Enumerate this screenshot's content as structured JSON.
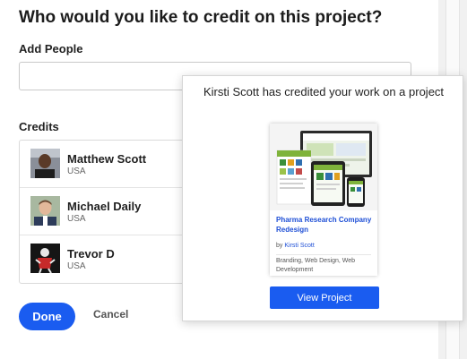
{
  "dialog": {
    "title": "Who would you like to credit on this project?",
    "add_people_label": "Add People",
    "add_people_value": "",
    "credits_label": "Credits",
    "credits": [
      {
        "name": "Matthew Scott",
        "location": "USA"
      },
      {
        "name": "Michael Daily",
        "location": "USA"
      },
      {
        "name": "Trevor D",
        "location": "USA"
      }
    ],
    "done_label": "Done",
    "cancel_label": "Cancel"
  },
  "popup": {
    "heading": "Kirsti Scott has credited your work on a project",
    "project_title": "Pharma Research Company Redesign",
    "by_prefix": "by",
    "author": "Kirsti Scott",
    "tags": "Branding, Web Design, Web Development",
    "button_label": "View Project"
  },
  "colors": {
    "accent": "#1a5cf0",
    "link": "#1e4fd6",
    "title_text": "#1c1c1c"
  }
}
